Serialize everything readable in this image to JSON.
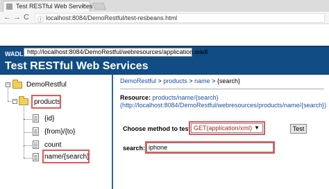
{
  "browser": {
    "tab_title": "Test RESTful Web Services",
    "tab_close": "×",
    "back_glyph": "←",
    "forward_glyph": "→",
    "reload_glyph": "C",
    "info_glyph": "ⓘ",
    "url": "localhost:8084/DemoRestful/test-resbeans.html"
  },
  "header": {
    "wadl_label": "WADL :",
    "wadl_url": "http://localhost:8084/DemoRestful/webresources/application.wadl",
    "title": "Test RESTful Web Services",
    "background": "#114c84"
  },
  "tree": {
    "root_label": "DemoRestful",
    "resource_label": "products",
    "children": [
      "{id}",
      "{from}/{to}",
      "count",
      "name/{search}"
    ]
  },
  "main": {
    "breadcrumb": {
      "root": "DemoRestful",
      "sep": " > ",
      "products": "products",
      "name": "name",
      "search": "{search}"
    },
    "resource_label": "Resource:",
    "resource_path": "products/name/{search}",
    "resource_full_url": "(http://localhost:8084/DemoRestful/webresources/products/name/{search})",
    "method_label": "Choose method to test:",
    "method_value": "GET(application/xml)",
    "method_arrow": "▼",
    "test_button": "Test",
    "search_label": "search:",
    "search_value": "iphone"
  },
  "colors": {
    "highlight": "#e05858",
    "link": "#1b4fa3",
    "method_text": "#b22222"
  }
}
